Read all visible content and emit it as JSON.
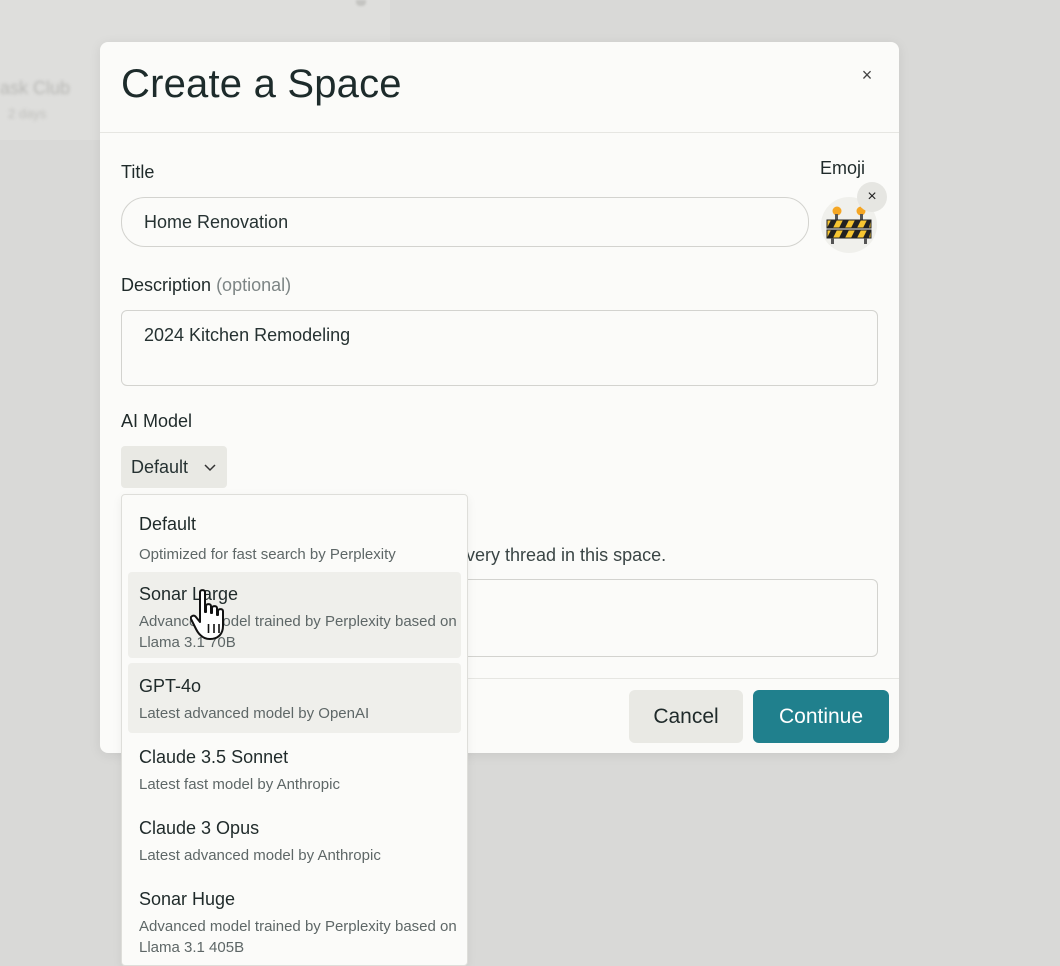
{
  "background": {
    "card_title": "ask Club",
    "card_sub": "2 days"
  },
  "modal": {
    "title": "Create a Space",
    "close_glyph": "×",
    "title_field": {
      "label": "Title",
      "value": "Home Renovation"
    },
    "emoji": {
      "label": "Emoji",
      "icon": "construction-barrier-icon",
      "remove_glyph": "×"
    },
    "description_field": {
      "label": "Description",
      "label_suffix": "(optional)",
      "value": "2024 Kitchen Remodeling"
    },
    "ai_model": {
      "label": "AI Model",
      "selected": "Default"
    },
    "instructions_hint": "very thread in this space.",
    "buttons": {
      "cancel": "Cancel",
      "continue": "Continue"
    },
    "accent_color": "#20808d"
  },
  "dropdown": {
    "options": [
      {
        "name": "Default",
        "desc": "Optimized for fast search by Perplexity",
        "highlighted": false
      },
      {
        "name": "Sonar Large",
        "desc": "Advanced model trained by Perplexity based on Llama 3.1 70B",
        "highlighted": true
      },
      {
        "name": "GPT-4o",
        "desc": "Latest advanced model by OpenAI",
        "highlighted": true
      },
      {
        "name": "Claude 3.5 Sonnet",
        "desc": "Latest fast model by Anthropic",
        "highlighted": false
      },
      {
        "name": "Claude 3 Opus",
        "desc": "Latest advanced model by Anthropic",
        "highlighted": false
      },
      {
        "name": "Sonar Huge",
        "desc": "Advanced model trained by Perplexity based on Llama 3.1 405B",
        "highlighted": false
      }
    ]
  }
}
